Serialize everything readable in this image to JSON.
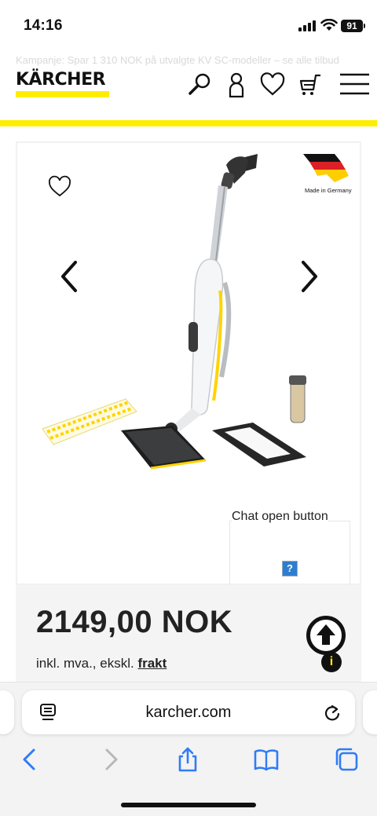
{
  "status": {
    "time": "14:16",
    "battery": "91"
  },
  "header": {
    "promo_text": "Kampanje: Spar 1 310 NOK på utvalgte KV SC-modeller – se alle tilbud",
    "logo": "KÄRCHER"
  },
  "product": {
    "made_in": "Made in Germany",
    "price": "2149,00 NOK",
    "tax_prefix": "inkl. mva., ekskl.",
    "tax_link": "frakt"
  },
  "chat": {
    "label": "Chat open button",
    "icon_text": "?"
  },
  "info": {
    "icon_text": "i"
  },
  "browser": {
    "url": "karcher.com"
  },
  "colors": {
    "brand_yellow": "#ffed00",
    "text": "#111111"
  }
}
